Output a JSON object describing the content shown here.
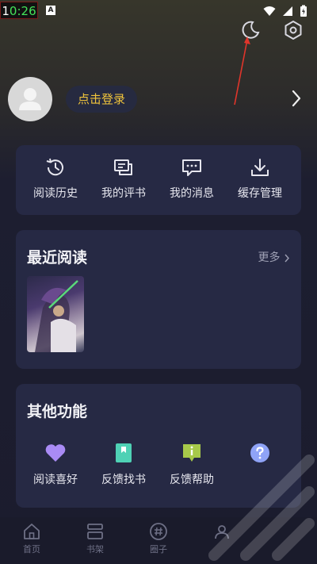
{
  "status": {
    "time_part1": "1",
    "time_part2": "0:26",
    "app_badge": "A"
  },
  "header": {
    "login_label": "点击登录"
  },
  "quick_actions": [
    {
      "label": "阅读历史",
      "icon": "history-icon"
    },
    {
      "label": "我的评书",
      "icon": "comment-icon"
    },
    {
      "label": "我的消息",
      "icon": "message-icon"
    },
    {
      "label": "缓存管理",
      "icon": "download-icon"
    }
  ],
  "recent": {
    "title": "最近阅读",
    "more_label": "更多"
  },
  "other": {
    "title": "其他功能",
    "items": [
      {
        "label": "阅读喜好",
        "icon": "heart-icon",
        "color": "#a98bf5"
      },
      {
        "label": "反馈找书",
        "icon": "bookmark-icon",
        "color": "#4fd1b5"
      },
      {
        "label": "反馈帮助",
        "icon": "info-icon",
        "color": "#a7c94a"
      },
      {
        "label": "",
        "icon": "question-icon",
        "color": "#8fa3f7"
      }
    ]
  },
  "tabs": [
    {
      "label": "首页",
      "icon": "home-icon"
    },
    {
      "label": "书架",
      "icon": "bookshelf-icon"
    },
    {
      "label": "圈子",
      "icon": "hashtag-icon"
    },
    {
      "label": "",
      "icon": "profile-icon"
    }
  ],
  "colors": {
    "accent": "#f0c43b",
    "card": "#262944",
    "background": "#1b1c2e"
  }
}
